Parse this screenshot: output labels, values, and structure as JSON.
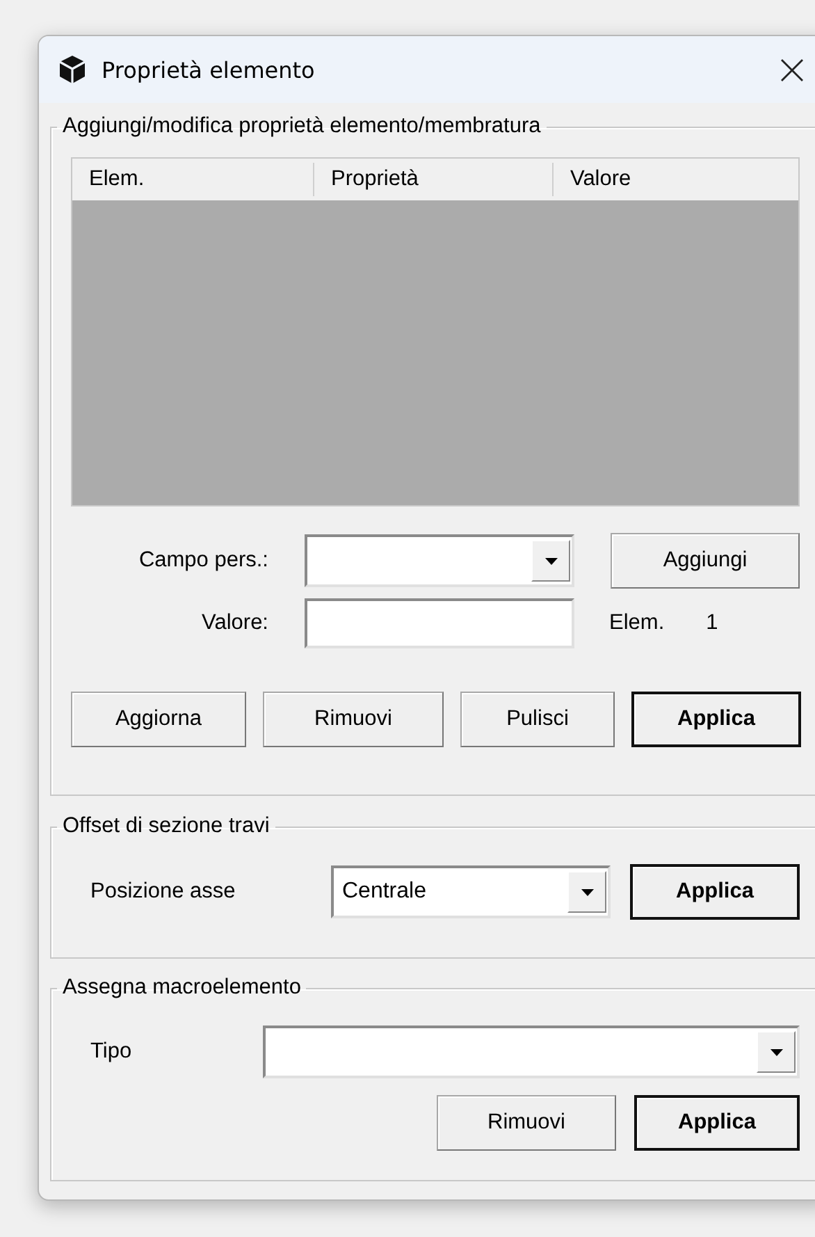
{
  "window": {
    "title": "Proprietà elemento"
  },
  "property_group": {
    "title": "Aggiungi/modifica proprietà elemento/membratura",
    "table": {
      "columns": [
        "Elem.",
        "Proprietà",
        "Valore"
      ]
    },
    "custom_field": {
      "label": "Campo pers.:"
    },
    "add_button": {
      "label": "Aggiungi",
      "default": false
    },
    "value_field": {
      "label": "Valore:"
    },
    "element_label": "Elem.",
    "element_count": "1",
    "buttons": [
      {
        "label": "Aggiorna",
        "default": false
      },
      {
        "label": "Rimuovi",
        "default": false
      },
      {
        "label": "Pulisci",
        "default": false
      },
      {
        "label": "Applica",
        "default": true
      }
    ]
  },
  "offset_group": {
    "title": "Offset di sezione travi",
    "axis_position": {
      "label": "Posizione asse",
      "value": "Centrale"
    },
    "apply_button": {
      "label": "Applica",
      "default": true
    }
  },
  "macro_group": {
    "title": "Assegna macroelemento",
    "type_field": {
      "label": "Tipo"
    },
    "buttons": [
      {
        "label": "Rimuovi",
        "default": false
      },
      {
        "label": "Applica",
        "default": true
      }
    ]
  }
}
